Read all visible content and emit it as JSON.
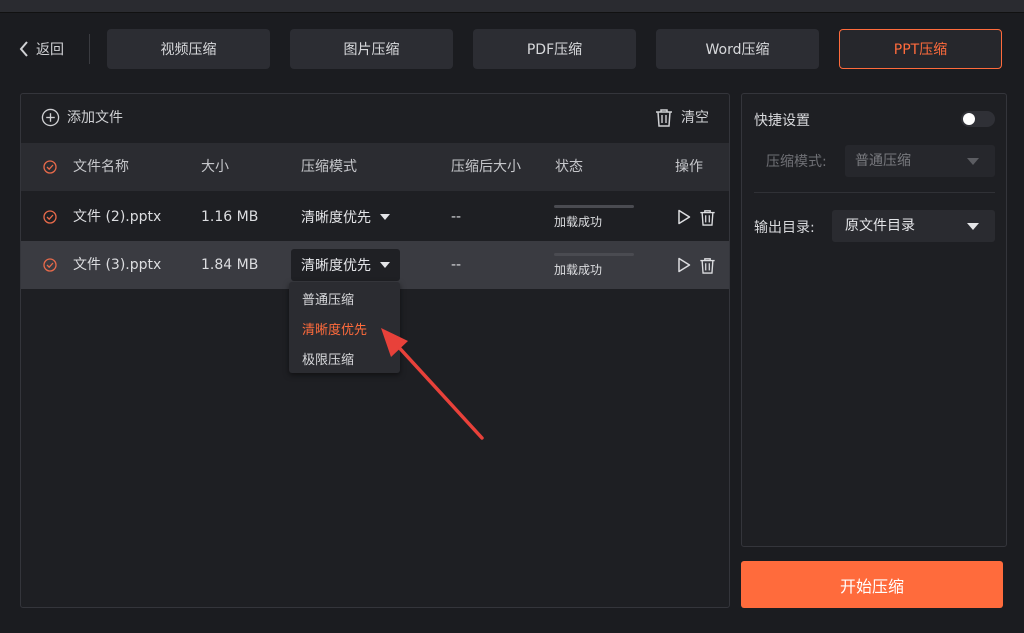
{
  "header": {
    "back_label": "返回",
    "tabs": [
      {
        "label": "视频压缩"
      },
      {
        "label": "图片压缩"
      },
      {
        "label": "PDF压缩"
      },
      {
        "label": "Word压缩"
      },
      {
        "label": "PPT压缩",
        "active": true
      }
    ]
  },
  "toolbar": {
    "add_file_label": "添加文件",
    "clear_label": "清空"
  },
  "table": {
    "columns": [
      "文件名称",
      "大小",
      "压缩模式",
      "压缩后大小",
      "状态",
      "操作"
    ],
    "rows": [
      {
        "name": "文件 (2).pptx",
        "size": "1.16 MB",
        "mode": "清晰度优先",
        "compressed_size": "--",
        "status": "加载成功",
        "selected": false
      },
      {
        "name": "文件 (3).pptx",
        "size": "1.84 MB",
        "mode": "清晰度优先",
        "compressed_size": "--",
        "status": "加载成功",
        "selected": true
      }
    ]
  },
  "mode_dropdown": {
    "options": [
      "普通压缩",
      "清晰度优先",
      "极限压缩"
    ],
    "selected": "清晰度优先"
  },
  "quick_settings": {
    "title": "快捷设置",
    "toggle_on": false,
    "mode_label": "压缩模式:",
    "mode_value": "普通压缩"
  },
  "output": {
    "label": "输出目录:",
    "value": "原文件目录"
  },
  "start_button": "开始压缩",
  "colors": {
    "accent": "#ff6b3c",
    "background": "#1b1c20",
    "panel": "#1e1f23",
    "arrow": "#e8413a"
  }
}
